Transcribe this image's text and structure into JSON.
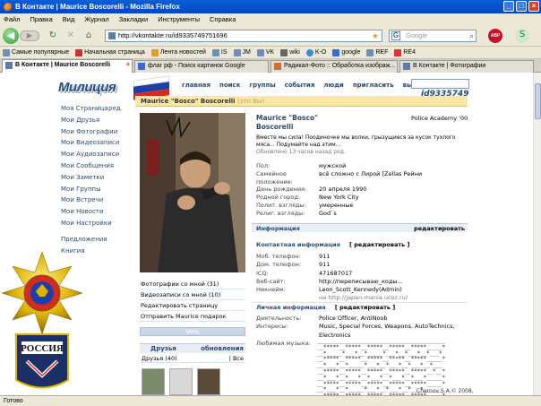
{
  "window": {
    "title": "В Контакте | Maurice Boscorelli - Mozilla Firefox",
    "btn_min": "_",
    "btn_max": "□",
    "btn_close": "×"
  },
  "menu": [
    "Файл",
    "Правка",
    "Вид",
    "Журнал",
    "Закладки",
    "Инструменты",
    "Справка"
  ],
  "nav": {
    "back": "◀",
    "forward": "▶",
    "reload": "↻",
    "stop": "✕",
    "home": "⌂",
    "url": "http://vkontakte.ru/id9335749751696",
    "search_placeholder": "Google",
    "search_engine": "G",
    "abp": "ABP"
  },
  "bookmarks": [
    "Самые популярные",
    "Начальная страница",
    "Лента новостей",
    "IS",
    "JM",
    "VK",
    "wiki",
    "K-O",
    "google",
    "REF",
    "RE4"
  ],
  "tabs": [
    {
      "label": "В Контакте | Maurice Boscorelli",
      "active": true
    },
    {
      "label": "флаг рф - Поиск картинок Google",
      "active": false
    },
    {
      "label": "Радикал-Фото :: Обработка изображ...",
      "active": false
    },
    {
      "label": "В Контакте | Фотографии",
      "active": false
    }
  ],
  "site": {
    "logo_text": "Милиция",
    "flag_colors": [
      "#ffffff",
      "#1c3fa8",
      "#d52b1e"
    ],
    "topnav": [
      "главная",
      "поиск",
      "группы",
      "события",
      "люди",
      "пригласить",
      "выйти"
    ],
    "user_id": "id9335749"
  },
  "leftnav": {
    "edit": "ред.",
    "items": [
      "Моя Страница",
      "Мои Друзья",
      "Мои Фотографии",
      "Мои Видеозаписи",
      "Мои Аудиозаписи",
      "Мои Сообщения",
      "Мои Заметки",
      "Мои Группы",
      "Мои Встречи",
      "Мои Новости",
      "Мои Настройки"
    ],
    "extra": [
      "Предложения",
      "Книгия"
    ]
  },
  "profile": {
    "header_name": "Maurice \"Bosco\" Boscorelli",
    "header_you": "(это Вы)",
    "name_line1": "Maurice \"Bosco\"",
    "name_line2": "Boscorelli",
    "school": "Police Academy '00",
    "status_line1": "Вместе мы сила! Поодиночке мы волки, грызущиеся за кусок тухлого",
    "status_line2": "мяса... Подумайте над этим...",
    "status_updated": "Обновлено 13 часов назад ред.",
    "info": [
      {
        "k": "Пол:",
        "v": "мужской"
      },
      {
        "k": "Семейное положение:",
        "v": "всё сложно с Лирой [Zellas Рейни"
      },
      {
        "k": "День рождения:",
        "v": "20 апреля 1990"
      },
      {
        "k": "Родной город:",
        "v": "New York City"
      },
      {
        "k": "Полит. взгляды:",
        "v": "умеренные"
      },
      {
        "k": "Религ. взгляды:",
        "v": "God`s"
      }
    ],
    "info_header": "Информация",
    "info_edit": "редактировать",
    "contact_header": "Контактная информация",
    "contact_edit": "[ редактировать ]",
    "contacts": [
      {
        "k": "Моб. телефон:",
        "v": "911"
      },
      {
        "k": "Дом. телефон:",
        "v": "911"
      },
      {
        "k": "ICQ:",
        "v": "471687017"
      },
      {
        "k": "Веб-сайт:",
        "v": "http://переписываю_коды..."
      },
      {
        "k": "Никнейм:",
        "v": "Leon_Scott_Kennedy(Admin)"
      }
    ],
    "contact_note": "на http://japan-mania.ucoz.ru/",
    "personal_header": "Личная информация",
    "personal_edit": "[ редактировать ]",
    "personal": [
      {
        "k": "Деятельность:",
        "v": "Police Officer, AntiNoob"
      },
      {
        "k": "Интересы:",
        "v": "Music, Special Forces, Weapons, AutoTechnics, Electronics"
      },
      {
        "k": "Любимая музыка:",
        "v": ""
      }
    ],
    "ascii_art": "_________________________________________\n__*****__*****__*****__*****__*****_____*\n__*_____*___*__*_____*___*__*___*__*___*\n__*****__*****__*****__*****__*****_____*\n__*___*__*_____*___*__*___*__*___*__*___\n__*****__*****__*****__*****__*****__*__*\n__*___*__*___*__*___*__*___*__*___*_____*\n__*****__*****__*****__*****__*****_____*\n__*___*__*_____*___*__*___*__*___*______\n__*****__*****__*****__*****__*****_____*\n_________________________________________",
    "copyright": "Chernov S.A.© 2008,"
  },
  "photo_links": [
    "Фотографии со мной (31)",
    "Видеозаписи со мной (10)",
    "Редактировать страницу",
    "Отправить Maurice подарок"
  ],
  "rating": "99%",
  "friends": {
    "label": "Друзья",
    "updates": "обновления",
    "count": "Друзья (40)",
    "all": "Все"
  },
  "statusbar": "Готово"
}
